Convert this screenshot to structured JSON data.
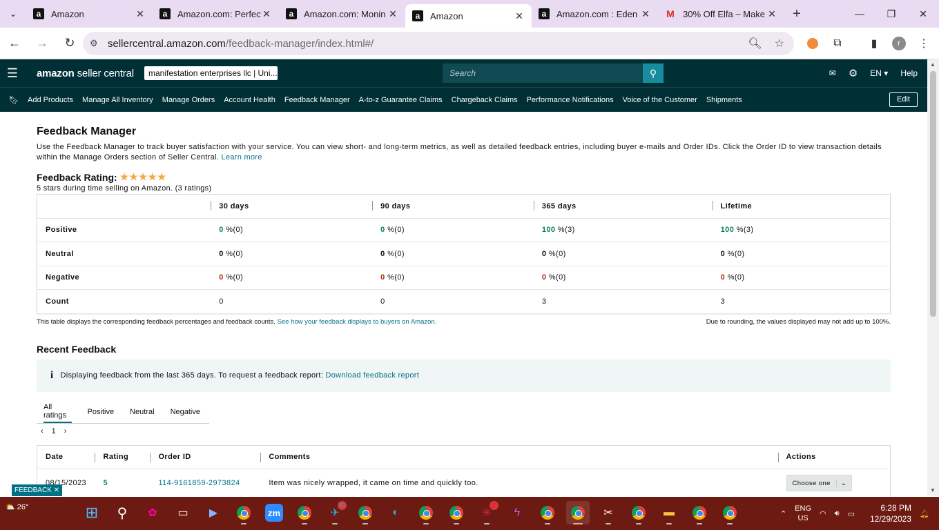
{
  "browser": {
    "tabs": [
      {
        "title": "Amazon",
        "icon": "amazon-icon",
        "active": false
      },
      {
        "title": "Amazon.com: Perfect",
        "icon": "amazon-icon",
        "active": false
      },
      {
        "title": "Amazon.com: Monin",
        "icon": "amazon-icon",
        "active": false
      },
      {
        "title": "Amazon",
        "icon": "amazon-icon",
        "active": true
      },
      {
        "title": "Amazon.com : Eden F",
        "icon": "amazon-icon",
        "active": false
      },
      {
        "title": "30% Off Elfa – Make",
        "icon": "gmail-icon",
        "active": false
      }
    ],
    "url_host": "sellercentral.amazon.com",
    "url_path": "/feedback-manager/index.html#/",
    "profile_initial": "r"
  },
  "header": {
    "logo_bold": "amazon",
    "logo_rest": " seller central",
    "account": "manifestation enterprises llc | Uni...",
    "search_placeholder": "Search",
    "language": "EN",
    "help": "Help"
  },
  "nav": {
    "items": [
      "Add Products",
      "Manage All Inventory",
      "Manage Orders",
      "Account Health",
      "Feedback Manager",
      "A-to-z Guarantee Claims",
      "Chargeback Claims",
      "Performance Notifications",
      "Voice of the Customer",
      "Shipments"
    ],
    "edit": "Edit"
  },
  "page": {
    "title": "Feedback Manager",
    "intro": "Use the Feedback Manager to track buyer satisfaction with your service. You can view short- and long-term metrics, as well as detailed feedback entries, including buyer e-mails and Order IDs. Click the Order ID to view transaction details within the Manage Orders section of Seller Central.",
    "learn_more": "Learn more",
    "rating_label": "Feedback Rating:",
    "stars": 5,
    "rating_sub": "5 stars during time selling on Amazon. (3 ratings)"
  },
  "rating_table": {
    "columns": [
      "",
      "30 days",
      "90 days",
      "365 days",
      "Lifetime"
    ],
    "rows": [
      {
        "label": "Positive",
        "type": "pos",
        "cells": [
          {
            "v": "0",
            "r": " %(0)"
          },
          {
            "v": "0",
            "r": " %(0)"
          },
          {
            "v": "100",
            "r": " %(3)"
          },
          {
            "v": "100",
            "r": " %(3)"
          }
        ]
      },
      {
        "label": "Neutral",
        "type": "neu",
        "cells": [
          {
            "v": "0",
            "r": " %(0)"
          },
          {
            "v": "0",
            "r": " %(0)"
          },
          {
            "v": "0",
            "r": " %(0)"
          },
          {
            "v": "0",
            "r": " %(0)"
          }
        ]
      },
      {
        "label": "Negative",
        "type": "neg",
        "cells": [
          {
            "v": "0",
            "r": " %(0)"
          },
          {
            "v": "0",
            "r": " %(0)"
          },
          {
            "v": "0",
            "r": " %(0)"
          },
          {
            "v": "0",
            "r": " %(0)"
          }
        ]
      },
      {
        "label": "Count",
        "type": "cnt",
        "cells": [
          {
            "v": "0",
            "r": ""
          },
          {
            "v": "0",
            "r": ""
          },
          {
            "v": "3",
            "r": ""
          },
          {
            "v": "3",
            "r": ""
          }
        ]
      }
    ],
    "footnote_left": "This table displays the corresponding feedback percentages and feedback counts.",
    "footnote_link": "See how your feedback displays to buyers on Amazon.",
    "footnote_right": "Due to rounding, the values displayed may not add up to 100%."
  },
  "recent": {
    "title": "Recent Feedback",
    "info": "Displaying feedback from the last 365 days. To request a feedback report:",
    "info_link": "Download feedback report",
    "tabs": [
      "All ratings",
      "Positive",
      "Neutral",
      "Negative"
    ],
    "page": "1",
    "columns": [
      "Date",
      "Rating",
      "Order ID",
      "Comments",
      "Actions"
    ],
    "rows": [
      {
        "date": "08/15/2023",
        "rating": "5",
        "order_id": "114-9161859-2973824",
        "comment": "Item was nicely wrapped, it came on time and quickly too.",
        "action": "Choose one"
      }
    ]
  },
  "feedback_tab": "FEEDBACK ✕",
  "taskbar": {
    "temperature": "26°",
    "lang_top": "ENG",
    "lang_bottom": "US",
    "time": "6:28 PM",
    "date": "12/29/2023",
    "telegram_badge": "82",
    "slack_badge": "2"
  },
  "colors": {
    "header_bg": "#002f36",
    "link": "#007185",
    "positive": "#067d62",
    "negative": "#b12704",
    "taskbar": "#6d1a12"
  }
}
